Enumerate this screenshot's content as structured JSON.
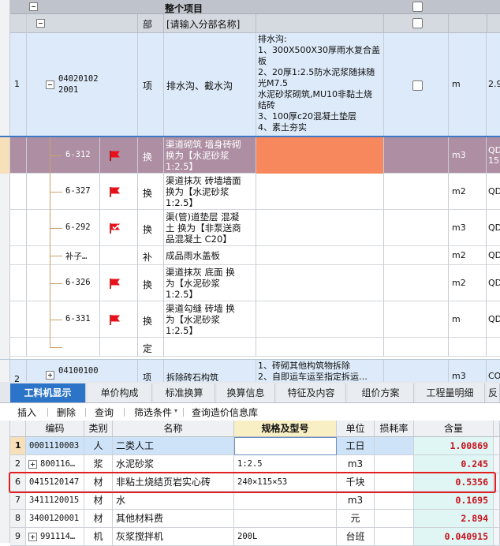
{
  "upper": {
    "root": {
      "label": "整个项目"
    },
    "section": {
      "type": "部",
      "name": "[请输入分部名称]"
    },
    "item": {
      "index": "1",
      "code_line1": "04020102",
      "code_line2": "2001",
      "type": "项",
      "name": "排水沟、截水沟",
      "features": [
        "排水沟:",
        "1、300X500X30厚雨水复合盖",
        "板",
        "2、20厚1:2.5防水泥浆随抹随",
        "光M7.5",
        "水泥砂浆砌筑,MU10非黏土烧",
        "结砖",
        "3、100厚c20混凝土垫层",
        "4、素土夯实"
      ],
      "unit": "m",
      "extra": "2.9"
    },
    "subs": [
      {
        "code": "6-312",
        "type": "换",
        "name": [
          "渠道砌筑 墙身砖砌",
          " 换为【水泥砂浆",
          "1:2.5】"
        ],
        "unit": "m3",
        "extra": [
          "QDI",
          "15"
        ],
        "flag": "red",
        "selected": true
      },
      {
        "code": "6-327",
        "type": "换",
        "name": [
          "渠道抹灰 砖墙墙面",
          " 换为【水泥砂浆",
          "1:2.5】"
        ],
        "unit": "m2",
        "extra": [
          "QDI"
        ],
        "flag": "red"
      },
      {
        "code": "6-292",
        "type": "换",
        "name": [
          "渠(管)道垫层 混凝",
          "土  换为【非泵送商",
          "品混凝土 C20】"
        ],
        "unit": "m3",
        "extra": [
          "QDI"
        ],
        "flag": "check"
      },
      {
        "code": "补子…",
        "type": "补",
        "name": [
          "成品雨水盖板"
        ],
        "unit": "m2",
        "extra": [
          "QDI"
        ],
        "flag": "none"
      },
      {
        "code": "6-326",
        "type": "换",
        "name": [
          "渠道抹灰 底面  换",
          "为【水泥砂浆",
          "1:2.5】"
        ],
        "unit": "m2",
        "extra": [
          "QDI"
        ],
        "flag": "red"
      },
      {
        "code": "6-331",
        "type": "换",
        "name": [
          "渠道勾缝 砖墙  换",
          "为【水泥砂浆",
          "1:2.5】"
        ],
        "unit": "m",
        "extra": [
          "QDI"
        ],
        "flag": "red"
      },
      {
        "code": "",
        "type": "定",
        "name": [
          ""
        ],
        "unit": "",
        "extra": [
          ""
        ],
        "flag": "none"
      }
    ],
    "next": {
      "index": "2",
      "code": "04100100",
      "type": "项",
      "name": "拆除砖石构筑",
      "features": [
        "1、砖砌其他构筑物拆除",
        "2、自即运车运至指定拆运…"
      ],
      "unit": "m3",
      "extra": "COI"
    }
  },
  "tabs": [
    "工料机显示",
    "单价构成",
    "标准换算",
    "换算信息",
    "特征及内容",
    "组价方案",
    "工程量明细",
    "反"
  ],
  "toolbar": {
    "insert": "插入",
    "delete": "删除",
    "query": "查询",
    "filter": "筛选条件",
    "price_db": "查询造价信息库"
  },
  "grid": {
    "headers": {
      "code": "编码",
      "category": "类别",
      "name": "名称",
      "spec": "规格及型号",
      "unit": "单位",
      "loss": "损耗率",
      "qty": "含量"
    },
    "rows": [
      {
        "index": "1",
        "code": "0001110003",
        "category": "人",
        "name": "二类人工",
        "spec": "",
        "unit": "工日",
        "qty": "1.00869",
        "expand": false
      },
      {
        "index": "2",
        "code": "800116…",
        "category": "浆",
        "name": "水泥砂浆",
        "spec": "1:2.5",
        "unit": "m3",
        "qty": "0.245",
        "expand": true
      },
      {
        "index": "6",
        "code": "0415120147",
        "category": "材",
        "name": "非粘土烧结页岩实心砖",
        "spec": "240×115×53",
        "unit": "千块",
        "qty": "0.5356",
        "expand": false
      },
      {
        "index": "7",
        "code": "3411120015",
        "category": "材",
        "name": "水",
        "spec": "",
        "unit": "m3",
        "qty": "0.1695",
        "expand": false
      },
      {
        "index": "8",
        "code": "3400120001",
        "category": "材",
        "name": "其他材料费",
        "spec": "",
        "unit": "元",
        "qty": "2.894",
        "expand": false
      },
      {
        "index": "9",
        "code": "991114…",
        "category": "机",
        "name": "灰浆搅拌机",
        "spec": "200L",
        "unit": "台班",
        "qty": "0.040915",
        "expand": true
      }
    ]
  },
  "colors": {
    "accent": "#2b74c7",
    "selected_row": "#b08fa4",
    "orange_cell": "#f7875d",
    "highlight_box": "#e02020",
    "quantity_text": "#c8101b"
  }
}
